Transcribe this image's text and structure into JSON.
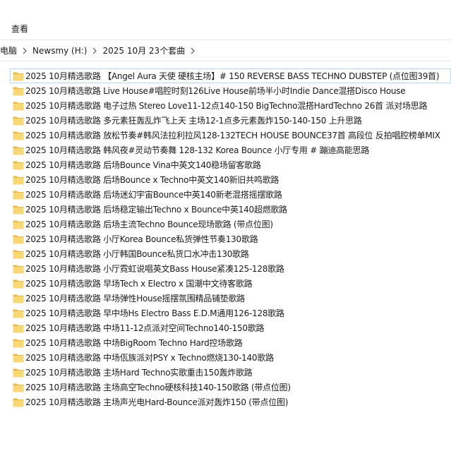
{
  "ribbon": {
    "tab_view": "查看"
  },
  "address": {
    "crumbs": [
      "电脑",
      "Newsmy (H:)",
      "2025 10月 23个套曲"
    ]
  },
  "folders": [
    "2025 10月精选歌路 【Angel Aura 天使 硬核主场】# 150 REVERSE BASS TECHNO DUBSTEP (点位图39首)",
    "2025 10月精选歌路 Live House#唱腔时刻126Live House前场半小时Indie Dance混搭Disco House",
    "2025 10月精选歌路 电子过热  Stereo Love11-12点140-150 BigTechno混搭HardTechno 26首 派对场思路",
    "2025 10月精选歌路 多元素狂轰乱炸飞上天 主场12-1点多元素轰炸150-140-150 上升思路",
    "2025 10月精选歌路 放松节奏#韩风法拉利拉风128-132TECH HOUSE BOUNCE37首 高段位 反拍唱腔榜单MIX",
    "2025 10月精选歌路 韩风夜#灵动节奏舞 128-132 Korea Bounce 小厅专用 # 蹦迪高能思路",
    "2025 10月精选歌路 后场Bounce Vina中英文140稳场留客歌路",
    "2025 10月精选歌路 后场Bounce x Techno中英文140新旧共鸣歌路",
    "2025 10月精选歌路 后场迷幻宇宙Bounce中英140新老混搭摇摆歌路",
    "2025 10月精选歌路 后场稳定输出Techno x Bounce中英140超燃歌路",
    "2025 10月精选歌路 后场主流Techno Bounce现场歌路 (带点位图)",
    "2025 10月精选歌路 小厅Korea Bounce私货弹性节奏130歌路",
    "2025 10月精选歌路 小厅韩国Bounce私货口水冲击130歌路",
    "2025 10月精选歌路 小厅霓虹说唱英文Bass House紧凑125-128歌路",
    "2025 10月精选歌路 早场Tech x Electro x 国潮中文待客歌路",
    "2025 10月精选歌路 早场弹性House摇摆氛围精品铺垫歌路",
    "2025 10月精选歌路 早中场Hs Electro Bass E.D.M通用126-128歌路",
    "2025 10月精选歌路 中场11-12点派对空间Techno140-150歌路",
    "2025 10月精选歌路 中场BigRoom Techno Hard控场歌路",
    "2025 10月精选歌路 中场佤族派对PSY x Techno燃烧130-140歌路",
    "2025 10月精选歌路 主场Hard Techno实歌重击150轰炸歌路",
    "2025 10月精选歌路 主场高空Techno硬核科技140-150歌路 (带点位图)",
    "2025 10月精选歌路 主场声光电Hard-Bounce派对轰炸150 (带点位图)"
  ],
  "colors": {
    "folder_body": "#f8d775",
    "folder_back": "#e8b84a",
    "selection_outline": "#b9d7f3"
  },
  "icons": {
    "folder": "folder-icon",
    "separator": "chevron-right-icon"
  }
}
